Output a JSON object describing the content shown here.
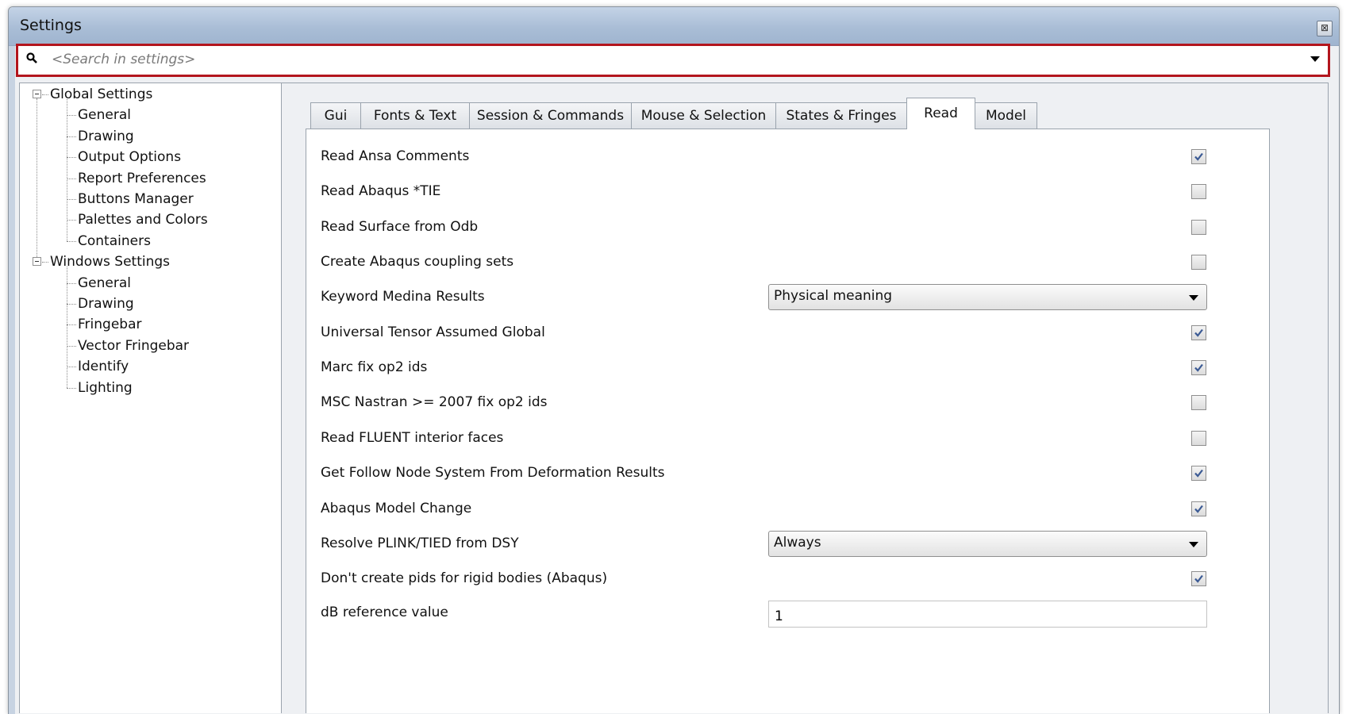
{
  "window": {
    "title": "Settings",
    "close_glyph": "⊠"
  },
  "search": {
    "placeholder": "<Search in settings>"
  },
  "tree": {
    "groups": [
      {
        "label": "Global Settings",
        "children": [
          "General",
          "Drawing",
          "Output Options",
          "Report Preferences",
          "Buttons Manager",
          "Palettes and Colors",
          "Containers"
        ]
      },
      {
        "label": "Windows Settings",
        "children": [
          "General",
          "Drawing",
          "Fringebar",
          "Vector Fringebar",
          "Identify",
          "Lighting"
        ]
      }
    ]
  },
  "tabs": [
    "Gui",
    "Fonts & Text",
    "Session & Commands",
    "Mouse & Selection",
    "States & Fringes",
    "Read",
    "Model"
  ],
  "active_tab": "Read",
  "settings": [
    {
      "label": "Read Ansa Comments",
      "type": "checkbox",
      "checked": true
    },
    {
      "label": "Read Abaqus *TIE",
      "type": "checkbox",
      "checked": false
    },
    {
      "label": "Read Surface from Odb",
      "type": "checkbox",
      "checked": false
    },
    {
      "label": "Create Abaqus coupling sets",
      "type": "checkbox",
      "checked": false
    },
    {
      "label": "Keyword Medina Results",
      "type": "select",
      "value": "Physical meaning"
    },
    {
      "label": "Universal Tensor Assumed Global",
      "type": "checkbox",
      "checked": true
    },
    {
      "label": "Marc fix op2 ids",
      "type": "checkbox",
      "checked": true
    },
    {
      "label": "MSC Nastran >= 2007 fix op2 ids",
      "type": "checkbox",
      "checked": false
    },
    {
      "label": "Read FLUENT interior faces",
      "type": "checkbox",
      "checked": false
    },
    {
      "label": "Get Follow Node System From Deformation Results",
      "type": "checkbox",
      "checked": true
    },
    {
      "label": "Abaqus Model Change",
      "type": "checkbox",
      "checked": true
    },
    {
      "label": "Resolve PLINK/TIED from DSY",
      "type": "select",
      "value": "Always"
    },
    {
      "label": "Don't create pids for rigid bodies (Abaqus)",
      "type": "checkbox",
      "checked": true
    },
    {
      "label": "dB reference value",
      "type": "text",
      "value": "1"
    }
  ],
  "colors": {
    "search_border": "#b3151d",
    "check_mark": "#3b5a94",
    "title_bar": "#a9bdd6"
  },
  "icons": {
    "search": "search-icon",
    "close": "close-icon",
    "dropdown": "chevron-down-icon"
  }
}
